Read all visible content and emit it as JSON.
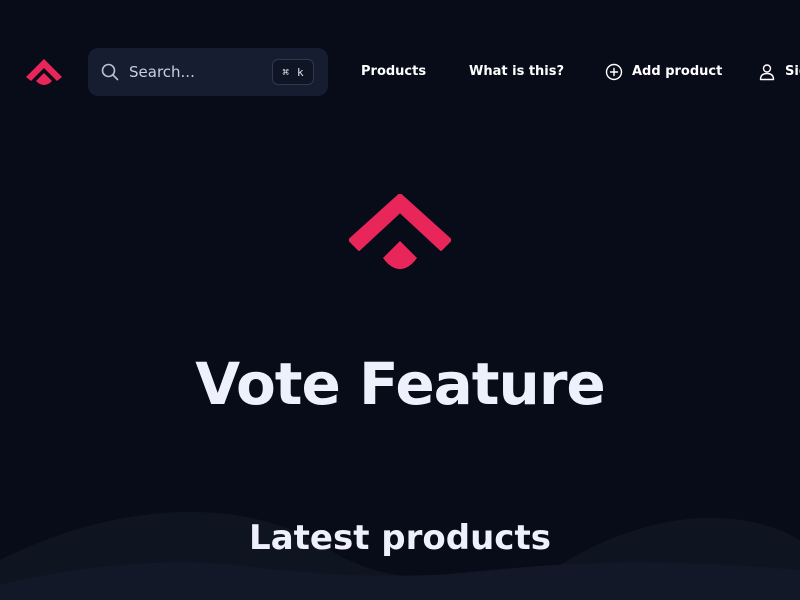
{
  "header": {
    "search": {
      "placeholder": "Search...",
      "shortcut_symbol": "⌘",
      "shortcut_key": "k"
    },
    "nav": {
      "products": "Products",
      "what_is_this": "What is this?",
      "add_product": "Add product",
      "sign_in": "Sign in"
    }
  },
  "hero": {
    "title": "Vote Feature"
  },
  "latest": {
    "title": "Latest products"
  },
  "colors": {
    "background": "#080b18",
    "brand": "#e8265a",
    "search_bg": "#161d30"
  }
}
